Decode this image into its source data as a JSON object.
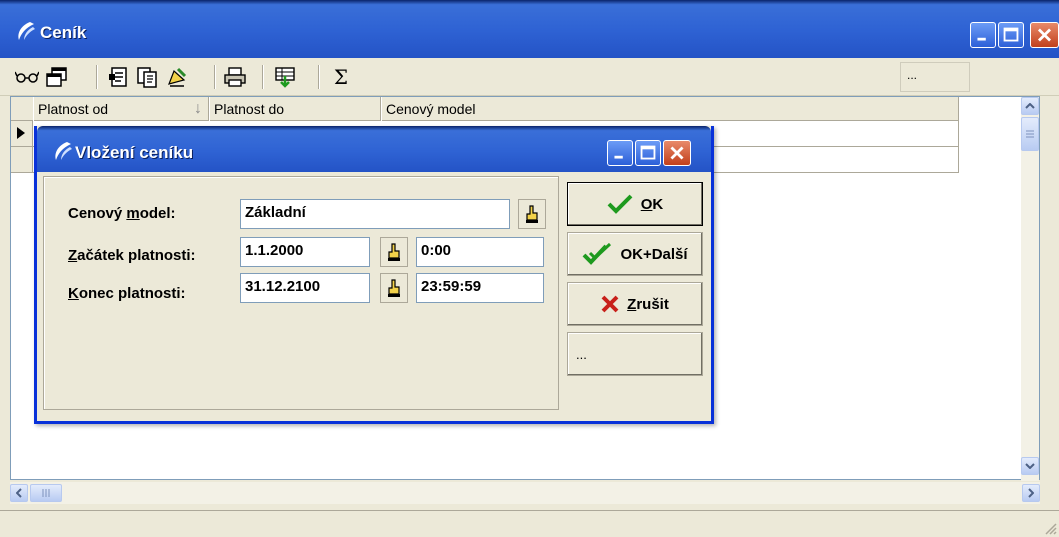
{
  "window": {
    "title": "Ceník"
  },
  "toolbar": {
    "icons": [
      "glasses-icon",
      "windows-icon",
      "document-icon",
      "copy-icon",
      "edit-icon",
      "print-icon",
      "export-icon",
      "sum-icon"
    ],
    "sum_label": "Σ",
    "more_label": "..."
  },
  "grid": {
    "columns": [
      "Platnost od",
      "Platnost do",
      "Cenový model"
    ],
    "sort_arrow": "↓"
  },
  "dialog": {
    "title": "Vložení ceníku",
    "fields": {
      "model": {
        "label_pre": "Cenový ",
        "label_u": "m",
        "label_post": "odel:",
        "value": "Základní"
      },
      "start": {
        "label_pre": "",
        "label_u": "Z",
        "label_post": "ačátek platnosti:",
        "date": "1.1.2000",
        "time": "0:00"
      },
      "end": {
        "label_pre": "",
        "label_u": "K",
        "label_post": "onec platnosti:",
        "date": "31.12.2100",
        "time": "23:59:59"
      }
    },
    "buttons": {
      "ok": {
        "u": "O",
        "rest": "K"
      },
      "ok_next": "OK+Další",
      "cancel": {
        "u": "Z",
        "rest": "rušit"
      },
      "more": "..."
    }
  },
  "colors": {
    "title_blue": "#2f63d4",
    "face": "#ece9d8",
    "check_green": "#1e9a1e",
    "cancel_red": "#c8201a"
  }
}
